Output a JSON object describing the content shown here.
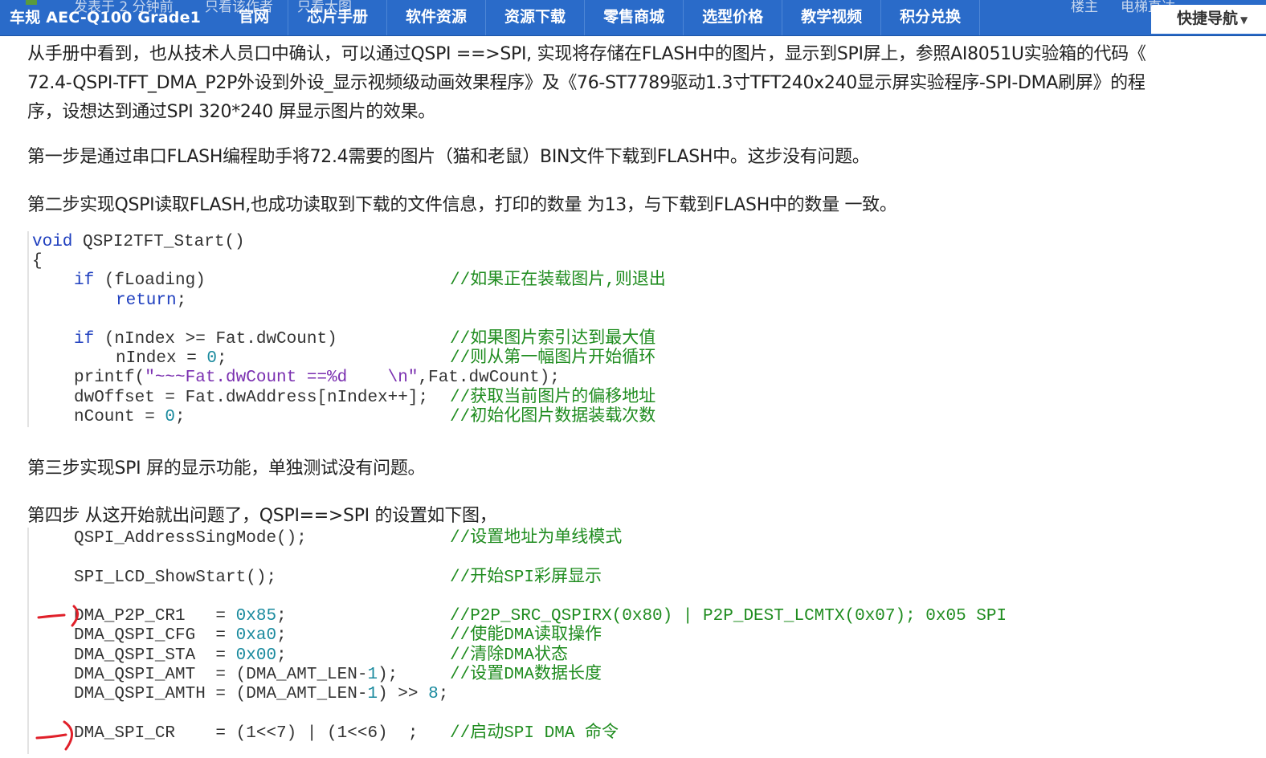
{
  "navbar": {
    "brand": "车规 AEC-Q100 Grade1",
    "ghost_text": [
      "发表于 2 分钟前",
      "只看该作者",
      "只看大图",
      "楼主",
      "电梯直达"
    ],
    "items": [
      "官网",
      "芯片手册",
      "软件资源",
      "资源下载",
      "零售商城",
      "选型价格",
      "教学视频",
      "积分兑换"
    ],
    "quick_nav": "快捷导航",
    "bg_color": "#2a6bc9"
  },
  "post": {
    "p1_lines": [
      "从手册中看到，也从技术人员口中确认，可以通过QSPI ==>SPI, 实现将存储在FLASH中的图片，显示到SPI屏上，参照AI8051U实验箱的代码《",
      "72.4-QSPI-TFT_DMA_P2P外设到外设_显示视频级动画效果程序》及《76-ST7789驱动1.3寸TFT240x240显示屏实验程序-SPI-DMA刷屏》的程",
      "序，设想达到通过SPI 320*240 屏显示图片的效果。"
    ],
    "p2": "第一步是通过串口FLASH编程助手将72.4需要的图片（猫和老鼠）BIN文件下载到FLASH中。这步没有问题。",
    "p3": "第二步实现QSPI读取FLASH,也成功读取到下载的文件信息，打印的数量 为13，与下载到FLASH中的数量 一致。",
    "p4": "第三步实现SPI 屏的显示功能，单独测试没有问题。",
    "p5": "第四步 从这开始就出问题了，QSPI==>SPI 的设置如下图，"
  },
  "code1": {
    "l0_kw": "void",
    "l0_rest": " QSPI2TFT_Start()",
    "l1": "{",
    "l2_kw": "if",
    "l2_rest": " (fLoading)",
    "l3_kw": "return",
    "l3_rest": ";",
    "l4_kw": "if",
    "l4_rest": " (nIndex >= Fat.dwCount)",
    "l5_a": "nIndex = ",
    "l5_num": "0",
    "l5_b": ";",
    "l6_a": "printf(",
    "l6_str": "\"~~~Fat.dwCount ==%d    \\n\"",
    "l6_b": ",Fat.dwCount);",
    "l7": "dwOffset = Fat.dwAddress[nIndex++];",
    "l8_a": "nCount = ",
    "l8_num": "0",
    "l8_b": ";",
    "c2": "//如果正在装载图片,则退出",
    "c4": "//如果图片索引达到最大值",
    "c5": "//则从第一幅图片开始循环",
    "c7": "//获取当前图片的偏移地址",
    "c8": "//初始化图片数据装载次数"
  },
  "code2": {
    "l0": "QSPI_AddressSingMode();",
    "l1": "SPI_LCD_ShowStart();",
    "l2_a": "DMA_P2P_CR1   = ",
    "l2_num": "0x85",
    "l2_b": ";",
    "l3_a": "DMA_QSPI_CFG  = ",
    "l3_num": "0xa0",
    "l3_b": ";",
    "l4_a": "DMA_QSPI_STA  = ",
    "l4_num": "0x00",
    "l4_b": ";",
    "l5_a": "DMA_QSPI_AMT  = (DMA_AMT_LEN-",
    "l5_num": "1",
    "l5_b": ");",
    "l6_a": "DMA_QSPI_AMTH = (DMA_AMT_LEN-",
    "l6_num": "1",
    "l6_b": ") >> ",
    "l6_num2": "8",
    "l6_c": ";",
    "l7": "DMA_SPI_CR    = (1<<7) | (1<<6)  ;",
    "c0": "//设置地址为单线模式",
    "c1": "//开始SPI彩屏显示",
    "c2": "//P2P_SRC_QSPIRX(0x80) | P2P_DEST_LCMTX(0x07); 0x05 SPI",
    "c3": "//使能DMA读取操作",
    "c4": "//清除DMA状态",
    "c5": "//设置DMA数据长度",
    "c7": "//启动SPI DMA 命令",
    "annotation_color": "#e0202a"
  }
}
